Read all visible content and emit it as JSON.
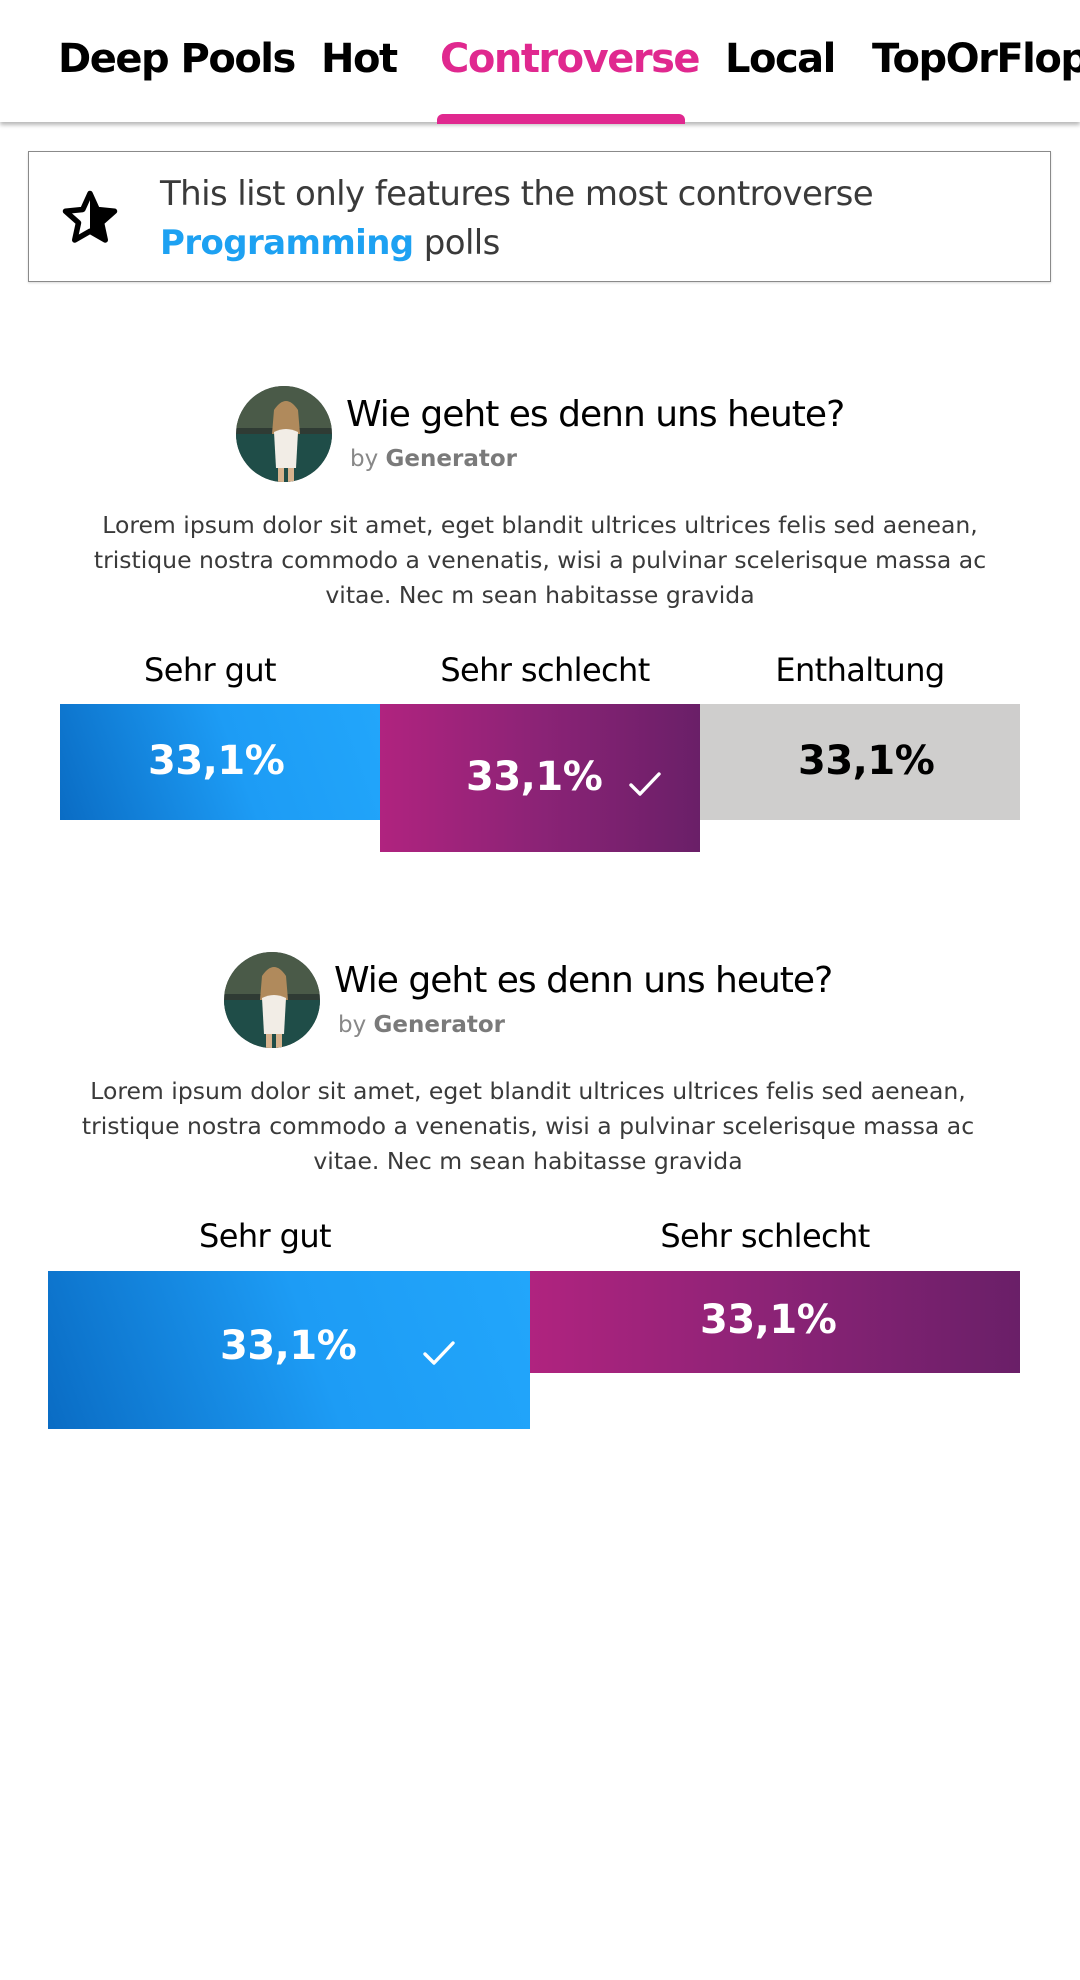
{
  "tabs": [
    {
      "label": "Deep Pools",
      "active": false
    },
    {
      "label": "Hot",
      "active": false
    },
    {
      "label": "Controverse",
      "active": true
    },
    {
      "label": "Local",
      "active": false
    },
    {
      "label": "TopOrFlop",
      "active": false
    }
  ],
  "banner": {
    "icon": "star-outline-icon",
    "text_before": "This list only features the most controverse",
    "topic": "Programming",
    "text_after": "polls"
  },
  "polls": [
    {
      "title": "Wie geht es denn uns heute?",
      "by_prefix": "by",
      "author": "Generator",
      "description": "Lorem ipsum dolor sit amet, eget blandit ultrices ultrices felis sed aenean, tristique nostra commodo a venenatis, wisi a pulvinar scelerisque massa ac vitae. Nec m sean habitasse gravida",
      "options": [
        {
          "label": "Sehr gut",
          "value": "33,1%",
          "selected": false
        },
        {
          "label": "Sehr schlecht",
          "value": "33,1%",
          "selected": true
        },
        {
          "label": "Enthaltung",
          "value": "33,1%",
          "selected": false
        }
      ]
    },
    {
      "title": "Wie geht es denn uns heute?",
      "by_prefix": "by",
      "author": "Generator",
      "description": "Lorem ipsum dolor sit amet, eget blandit ultrices ultrices felis sed aenean, tristique nostra commodo a venenatis, wisi a pulvinar scelerisque massa ac vitae. Nec m sean habitasse gravida",
      "options": [
        {
          "label": "Sehr gut",
          "value": "33,1%",
          "selected": true
        },
        {
          "label": "Sehr schlecht",
          "value": "33,1%",
          "selected": false
        }
      ]
    }
  ],
  "colors": {
    "accent": "#e0288f",
    "topic_link": "#1da1f2",
    "option_blue": "#1d9cf5",
    "option_purple": "#8b2376",
    "option_grey": "#cfcecd"
  }
}
